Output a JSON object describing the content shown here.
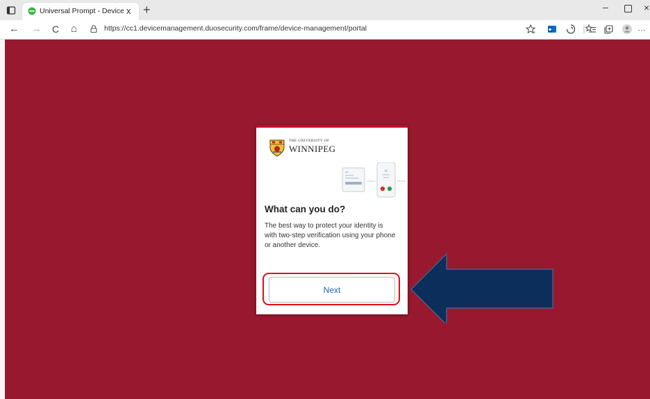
{
  "tab": {
    "title": "Universal Prompt - Device Mana",
    "close_glyph": "x",
    "new_tab_glyph": "+"
  },
  "window_controls": {
    "minimize": "–",
    "close": "×"
  },
  "address_bar": {
    "url": "https://cc1.devicemanagement.duosecurity.com/frame/device-management/portal"
  },
  "nav": {
    "back": "←",
    "forward": "→",
    "reload": "C",
    "home": "⌂"
  },
  "toolbar_icons": [
    "add-favorite-icon",
    "outlook-extension-icon",
    "browser-essentials-icon",
    "favorites-icon",
    "collections-icon",
    "profile-icon",
    "more-icon"
  ],
  "more_glyph": "···",
  "brand": {
    "small": "THE UNIVERSITY OF",
    "name": "WINNIPEG"
  },
  "card": {
    "title": "What can you do?",
    "description": "The best way to protect your identity is with two-step verification using your phone or another device.",
    "next_label": "Next"
  },
  "colors": {
    "page_background": "#98182f",
    "card_top_border": "#c8102e",
    "highlight_outline": "#e10b18",
    "arrow_fill": "#0b2e5b",
    "next_text": "#1f5fb3"
  }
}
